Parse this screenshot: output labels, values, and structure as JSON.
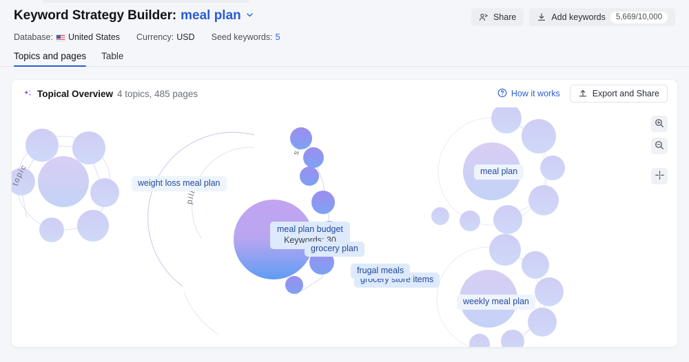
{
  "header": {
    "title": "Keyword Strategy Builder:",
    "keyword": "meal plan",
    "chevron_icon": "chevron-down-icon",
    "meta": {
      "database_label": "Database:",
      "database_value": "United States",
      "flag_icon": "us-flag-icon",
      "currency_label": "Currency:",
      "currency_value": "USD",
      "seed_label": "Seed keywords:",
      "seed_value": "5"
    },
    "share_button": "Share",
    "share_icon": "users-icon",
    "add_keywords_button": "Add keywords",
    "add_keywords_icon": "download-icon",
    "add_keywords_count": "5,669/10,000"
  },
  "tabs": [
    {
      "label": "Topics and pages",
      "active": true
    },
    {
      "label": "Table",
      "active": false
    }
  ],
  "card": {
    "sparkle_icon": "sparkle-icon",
    "title": "Topical Overview",
    "subtitle": "4 topics, 485 pages",
    "how_it_works": "How it works",
    "how_it_works_icon": "question-circle-icon",
    "export_button": "Export and Share",
    "export_icon": "upload-icon"
  },
  "zoom_controls": [
    {
      "name": "zoom-in-button",
      "icon": "magnifier-plus-icon"
    },
    {
      "name": "zoom-out-button",
      "icon": "magnifier-minus-icon"
    },
    {
      "name": "fit-to-screen-button",
      "icon": "crosshair-icon"
    }
  ],
  "graph": {
    "arc_labels": [
      {
        "text": "topic"
      },
      {
        "text": "pillar"
      },
      {
        "text": "subs"
      }
    ],
    "clusters": [
      {
        "name": "weight loss meal plan",
        "label": "weight loss meal plan"
      },
      {
        "name": "meal plan budget",
        "label": "meal plan budget",
        "keywords": "Keywords: 30",
        "pillar": true
      },
      {
        "name": "meal plan",
        "label": "meal plan"
      },
      {
        "name": "weekly meal plan",
        "label": "weekly meal plan"
      }
    ],
    "subtopics": [
      {
        "label": "grocery plan"
      },
      {
        "label": "grocery store items"
      },
      {
        "label": "frugal meals"
      }
    ]
  },
  "colors": {
    "accent_blue": "#2a5bd7",
    "chip_bg": "#ddeafb",
    "chip_text": "#23489c",
    "bubble_lavender": "#cdd2f5",
    "pillar_top": "#b99bec",
    "pillar_bottom": "#62a0f2",
    "sparkle_purple": "#7b4ae2",
    "page_bg": "#f5f6f9"
  }
}
